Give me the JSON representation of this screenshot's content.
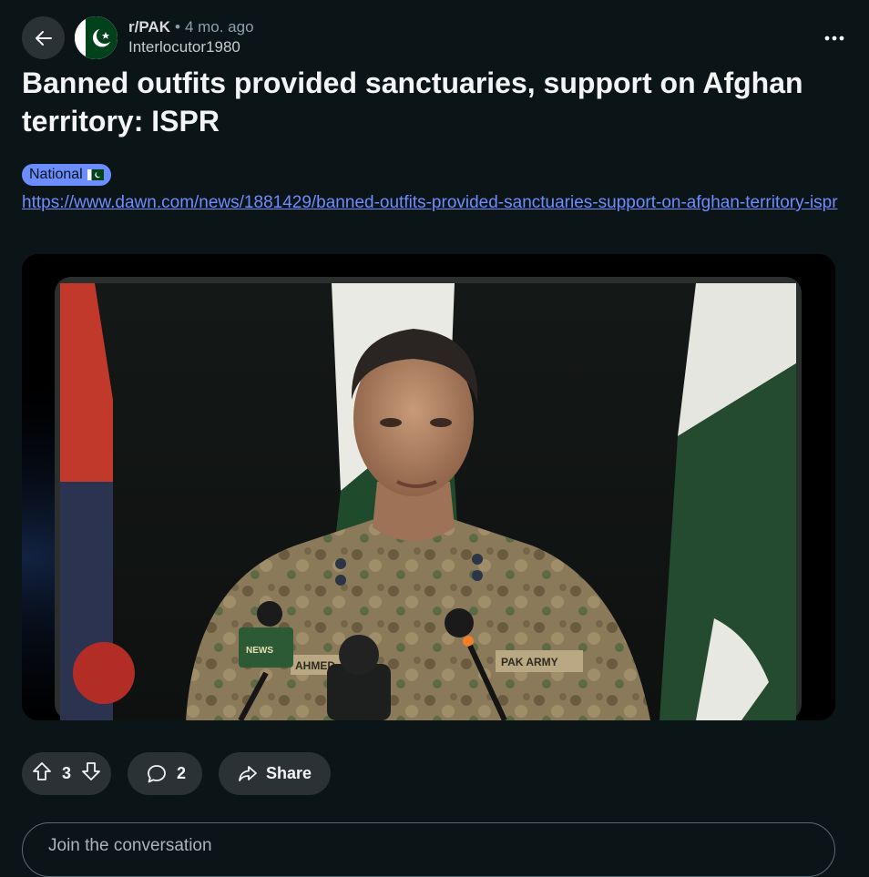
{
  "post": {
    "subreddit": "r/PAK",
    "age": "4 mo. ago",
    "author": "Interlocutor1980",
    "title": "Banned outfits provided sanctuaries, support on Afghan territory: ISPR",
    "flair": "National",
    "url": "https://www.dawn.com/news/1881429/banned-outfits-provided-sanctuaries-support-on-afghan-territory-ispr",
    "image_text": {
      "mic_label": "NEWS",
      "name_tag": "AHMED",
      "army_tag": "PAK ARMY"
    }
  },
  "actions": {
    "upvotes": "3",
    "comments": "2",
    "share_label": "Share"
  },
  "composer": {
    "placeholder": "Join the conversation"
  },
  "icons": {
    "back": "arrow-left-icon",
    "more": "more-horizontal-icon",
    "upvote": "arrow-up-icon",
    "downvote": "arrow-down-icon",
    "comment": "speech-bubble-icon",
    "share": "share-arrow-icon"
  },
  "colors": {
    "background": "#0b1416",
    "pill": "#2a3236",
    "link": "#6f8dff",
    "flair": "#6b8dff",
    "flag_green": "#01411c"
  }
}
